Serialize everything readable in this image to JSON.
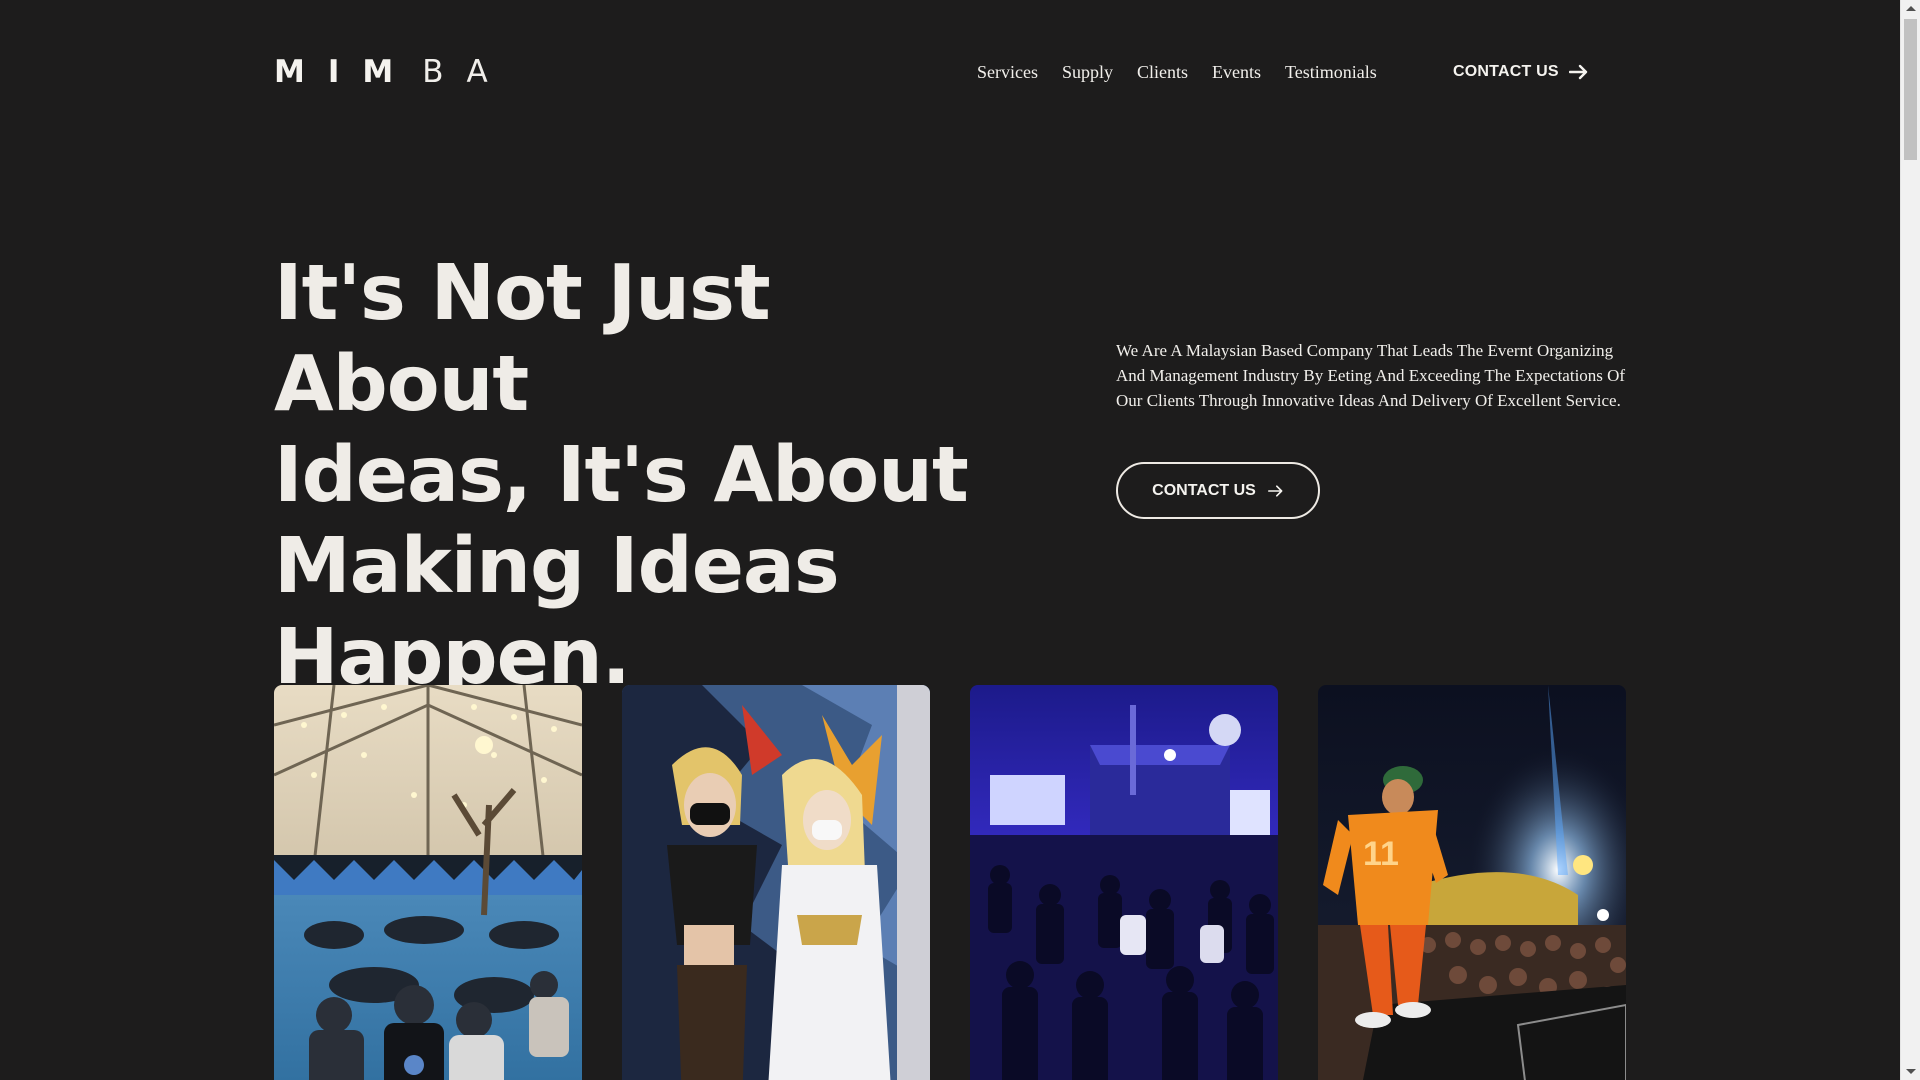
{
  "header": {
    "logo": {
      "parts": [
        "M",
        "I",
        "M",
        "B",
        "A"
      ]
    },
    "nav": [
      "Services",
      "Supply",
      "Clients",
      "Events",
      "Testimonials"
    ],
    "contact_label": "CONTACT US"
  },
  "hero": {
    "headline_lines": [
      "It's Not Just About",
      "Ideas, It's About",
      "Making Ideas",
      "Happen."
    ],
    "description": "We Are A Malaysian Based Company That Leads The Evernt Organizing And Management Industry By Eeting And Exceeding The Expectations Of Our Clients Through Innovative Ideas And Delivery Of Excellent Service.",
    "contact_label": "CONTACT US"
  },
  "gallery": {
    "images": [
      {
        "icon": "festival-tent-crowd-photo"
      },
      {
        "icon": "cosplay-photo"
      },
      {
        "icon": "concert-stage-crowd-photo"
      },
      {
        "icon": "performer-on-stage-photo"
      }
    ]
  },
  "colors": {
    "background": "#1d1c1c",
    "text": "#f0eeea"
  }
}
